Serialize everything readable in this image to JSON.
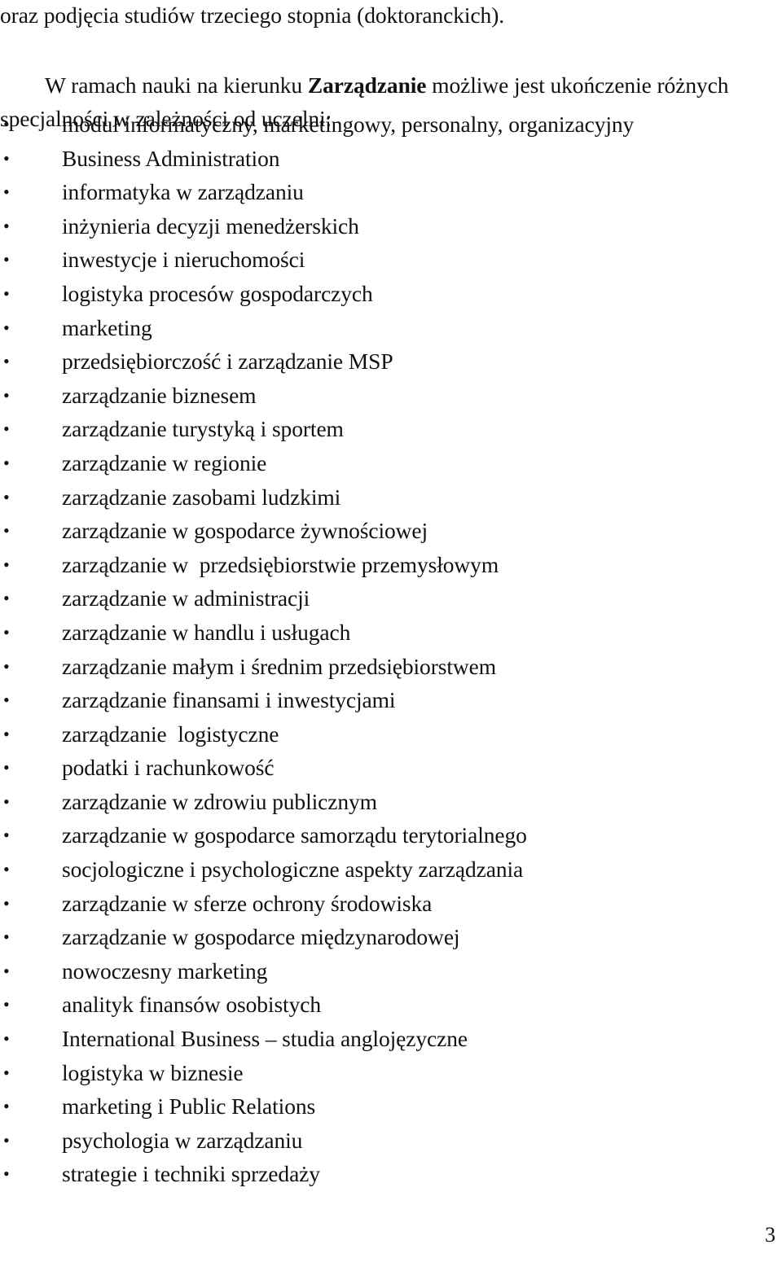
{
  "document": {
    "lead_line": "oraz podjęcia studiów trzeciego stopnia (doktoranckich).",
    "intro": {
      "line1_before_bold": "W ramach nauki na kierunku ",
      "bold_term": "Zarządzanie",
      "line1_after_bold": " możliwe jest ukończenie różnych",
      "line2": "specjalności w zależności od uczelni:"
    },
    "bullet_glyph": "•",
    "specializations": [
      "moduł informatyczny, marketingowy, personalny, organizacyjny",
      "Business Administration",
      "informatyka w zarządzaniu",
      "inżynieria decyzji menedżerskich",
      "inwestycje i nieruchomości",
      "logistyka procesów gospodarczych",
      "marketing",
      "przedsiębiorczość i zarządzanie MSP",
      "zarządzanie biznesem",
      "zarządzanie turystyką i sportem",
      "zarządzanie w regionie",
      "zarządzanie zasobami ludzkimi",
      "zarządzanie w gospodarce żywnościowej",
      "zarządzanie w  przedsiębiorstwie przemysłowym",
      "zarządzanie w administracji",
      "zarządzanie w handlu i usługach",
      "zarządzanie małym i średnim przedsiębiorstwem",
      "zarządzanie finansami i inwestycjami",
      "zarządzanie  logistyczne",
      "podatki i rachunkowość",
      "zarządzanie w zdrowiu publicznym",
      "zarządzanie w gospodarce samorządu terytorialnego",
      "socjologiczne i psychologiczne aspekty zarządzania",
      "zarządzanie w sferze ochrony środowiska",
      "zarządzanie w gospodarce międzynarodowej",
      "nowoczesny marketing",
      "analityk finansów osobistych",
      "International Business – studia anglojęzyczne",
      "logistyka w biznesie",
      "marketing i Public Relations",
      "psychologia w zarządzaniu",
      "strategie i techniki sprzedaży"
    ],
    "page_number": "3",
    "colors": {
      "page_background": "#ffffff",
      "text": "#111111"
    }
  }
}
